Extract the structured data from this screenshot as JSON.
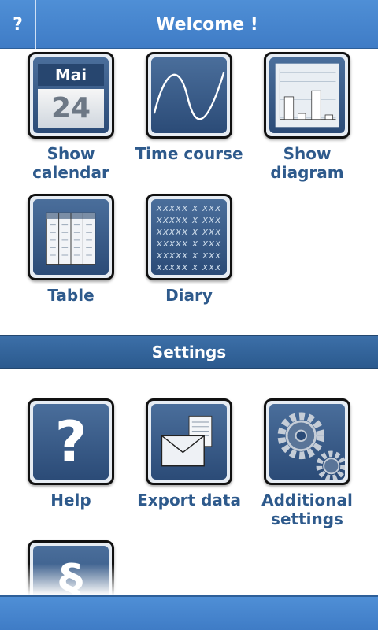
{
  "header": {
    "help_label": "?",
    "title": "Welcome !"
  },
  "main_tiles": [
    {
      "label_1": "Show",
      "label_2": "calendar",
      "calendar_month": "Mai",
      "calendar_day": "24"
    },
    {
      "label_1": "Time course"
    },
    {
      "label_1": "Show",
      "label_2": "diagram"
    },
    {
      "label_1": "Table"
    },
    {
      "label_1": "Diary",
      "diary_glyphs": "xxxxx x xxx"
    }
  ],
  "settings": {
    "title": "Settings",
    "tiles": [
      {
        "label_1": "Help",
        "glyph": "?"
      },
      {
        "label_1": "Export data"
      },
      {
        "label_1": "Additional",
        "label_2": "settings"
      },
      {
        "label_1": "",
        "glyph": "§"
      }
    ]
  },
  "colors": {
    "bar_blue": "#4f8fd6",
    "section_blue": "#2b5a8e",
    "label_blue": "#2e5a8c"
  }
}
